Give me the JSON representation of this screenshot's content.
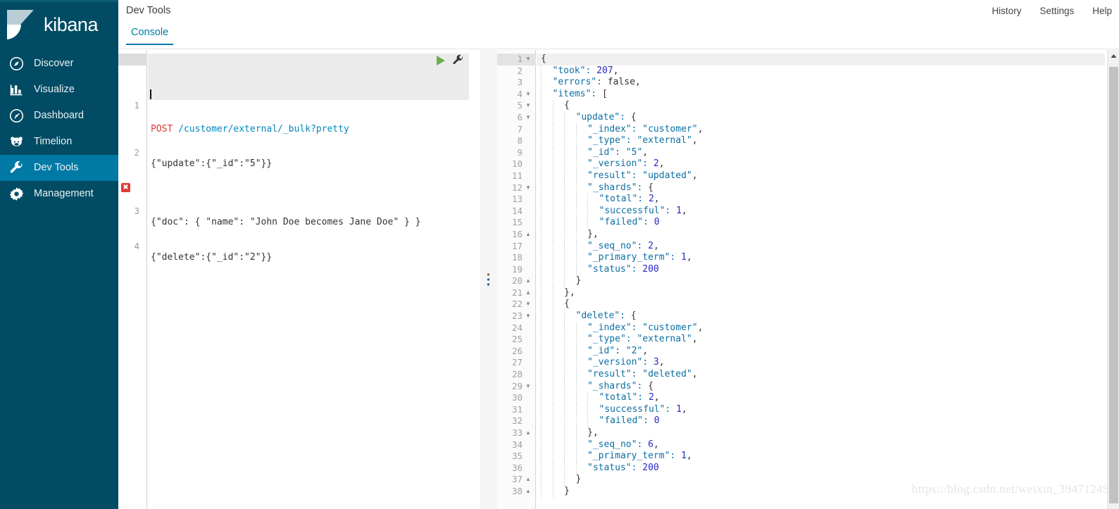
{
  "sidebar": {
    "brand": "kibana",
    "brand_icon": "kibana-logo",
    "items": [
      {
        "label": "Discover",
        "icon": "compass-icon",
        "active": false
      },
      {
        "label": "Visualize",
        "icon": "bar-chart-icon",
        "active": false
      },
      {
        "label": "Dashboard",
        "icon": "clock-icon",
        "active": false
      },
      {
        "label": "Timelion",
        "icon": "bear-icon",
        "active": false
      },
      {
        "label": "Dev Tools",
        "icon": "wrench-icon",
        "active": true
      },
      {
        "label": "Management",
        "icon": "gear-icon",
        "active": false
      }
    ]
  },
  "header": {
    "title": "Dev Tools",
    "actions": [
      "History",
      "Settings",
      "Help"
    ]
  },
  "tabs": [
    {
      "label": "Console",
      "active": true
    }
  ],
  "editor": {
    "run_icon": "play-icon",
    "wrench_icon": "wrench-icon",
    "error_icon": "error-x-icon",
    "lines": [
      {
        "num": "1",
        "method": "POST",
        "url": "/customer/external/_bulk?pretty",
        "error": false
      },
      {
        "num": "2",
        "text": "{\"update\":{\"_id\":\"5\"}}",
        "error": false
      },
      {
        "num": "3",
        "text": "{\"doc\": { \"name\": \"John Doe becomes Jane Doe\" } }",
        "error": true
      },
      {
        "num": "4",
        "text": "{\"delete\":{\"_id\":\"2\"}}",
        "error": false
      }
    ]
  },
  "response": {
    "lines": [
      {
        "num": "1",
        "fold": "open",
        "indent": 0,
        "text": "{"
      },
      {
        "num": "2",
        "fold": "",
        "indent": 1,
        "text": "\"took\": 207,"
      },
      {
        "num": "3",
        "fold": "",
        "indent": 1,
        "text": "\"errors\": false,"
      },
      {
        "num": "4",
        "fold": "open",
        "indent": 1,
        "text": "\"items\": ["
      },
      {
        "num": "5",
        "fold": "open",
        "indent": 2,
        "text": "{"
      },
      {
        "num": "6",
        "fold": "open",
        "indent": 3,
        "text": "\"update\": {"
      },
      {
        "num": "7",
        "fold": "",
        "indent": 4,
        "text": "\"_index\": \"customer\","
      },
      {
        "num": "8",
        "fold": "",
        "indent": 4,
        "text": "\"_type\": \"external\","
      },
      {
        "num": "9",
        "fold": "",
        "indent": 4,
        "text": "\"_id\": \"5\","
      },
      {
        "num": "10",
        "fold": "",
        "indent": 4,
        "text": "\"_version\": 2,"
      },
      {
        "num": "11",
        "fold": "",
        "indent": 4,
        "text": "\"result\": \"updated\","
      },
      {
        "num": "12",
        "fold": "open",
        "indent": 4,
        "text": "\"_shards\": {"
      },
      {
        "num": "13",
        "fold": "",
        "indent": 5,
        "text": "\"total\": 2,"
      },
      {
        "num": "14",
        "fold": "",
        "indent": 5,
        "text": "\"successful\": 1,"
      },
      {
        "num": "15",
        "fold": "",
        "indent": 5,
        "text": "\"failed\": 0"
      },
      {
        "num": "16",
        "fold": "close",
        "indent": 4,
        "text": "},"
      },
      {
        "num": "17",
        "fold": "",
        "indent": 4,
        "text": "\"_seq_no\": 2,"
      },
      {
        "num": "18",
        "fold": "",
        "indent": 4,
        "text": "\"_primary_term\": 1,"
      },
      {
        "num": "19",
        "fold": "",
        "indent": 4,
        "text": "\"status\": 200"
      },
      {
        "num": "20",
        "fold": "close",
        "indent": 3,
        "text": "}"
      },
      {
        "num": "21",
        "fold": "close",
        "indent": 2,
        "text": "},"
      },
      {
        "num": "22",
        "fold": "open",
        "indent": 2,
        "text": "{"
      },
      {
        "num": "23",
        "fold": "open",
        "indent": 3,
        "text": "\"delete\": {"
      },
      {
        "num": "24",
        "fold": "",
        "indent": 4,
        "text": "\"_index\": \"customer\","
      },
      {
        "num": "25",
        "fold": "",
        "indent": 4,
        "text": "\"_type\": \"external\","
      },
      {
        "num": "26",
        "fold": "",
        "indent": 4,
        "text": "\"_id\": \"2\","
      },
      {
        "num": "27",
        "fold": "",
        "indent": 4,
        "text": "\"_version\": 3,"
      },
      {
        "num": "28",
        "fold": "",
        "indent": 4,
        "text": "\"result\": \"deleted\","
      },
      {
        "num": "29",
        "fold": "open",
        "indent": 4,
        "text": "\"_shards\": {"
      },
      {
        "num": "30",
        "fold": "",
        "indent": 5,
        "text": "\"total\": 2,"
      },
      {
        "num": "31",
        "fold": "",
        "indent": 5,
        "text": "\"successful\": 1,"
      },
      {
        "num": "32",
        "fold": "",
        "indent": 5,
        "text": "\"failed\": 0"
      },
      {
        "num": "33",
        "fold": "close",
        "indent": 4,
        "text": "},"
      },
      {
        "num": "34",
        "fold": "",
        "indent": 4,
        "text": "\"_seq_no\": 6,"
      },
      {
        "num": "35",
        "fold": "",
        "indent": 4,
        "text": "\"_primary_term\": 1,"
      },
      {
        "num": "36",
        "fold": "",
        "indent": 4,
        "text": "\"status\": 200"
      },
      {
        "num": "37",
        "fold": "close",
        "indent": 3,
        "text": "}"
      },
      {
        "num": "38",
        "fold": "close",
        "indent": 2,
        "text": "}"
      }
    ],
    "scrollbar": {
      "up_icon": "scroll-up-arrow-icon"
    }
  },
  "splitter": {
    "handle_icon": "drag-dots-icon"
  },
  "watermark": "https://blog.csdn.net/weixin_39471249",
  "colors": {
    "sidebar_bg": "#014b64",
    "sidebar_active": "#0079a5",
    "accent": "#0079a5",
    "error": "#de3b35",
    "run": "#6ab04c"
  }
}
